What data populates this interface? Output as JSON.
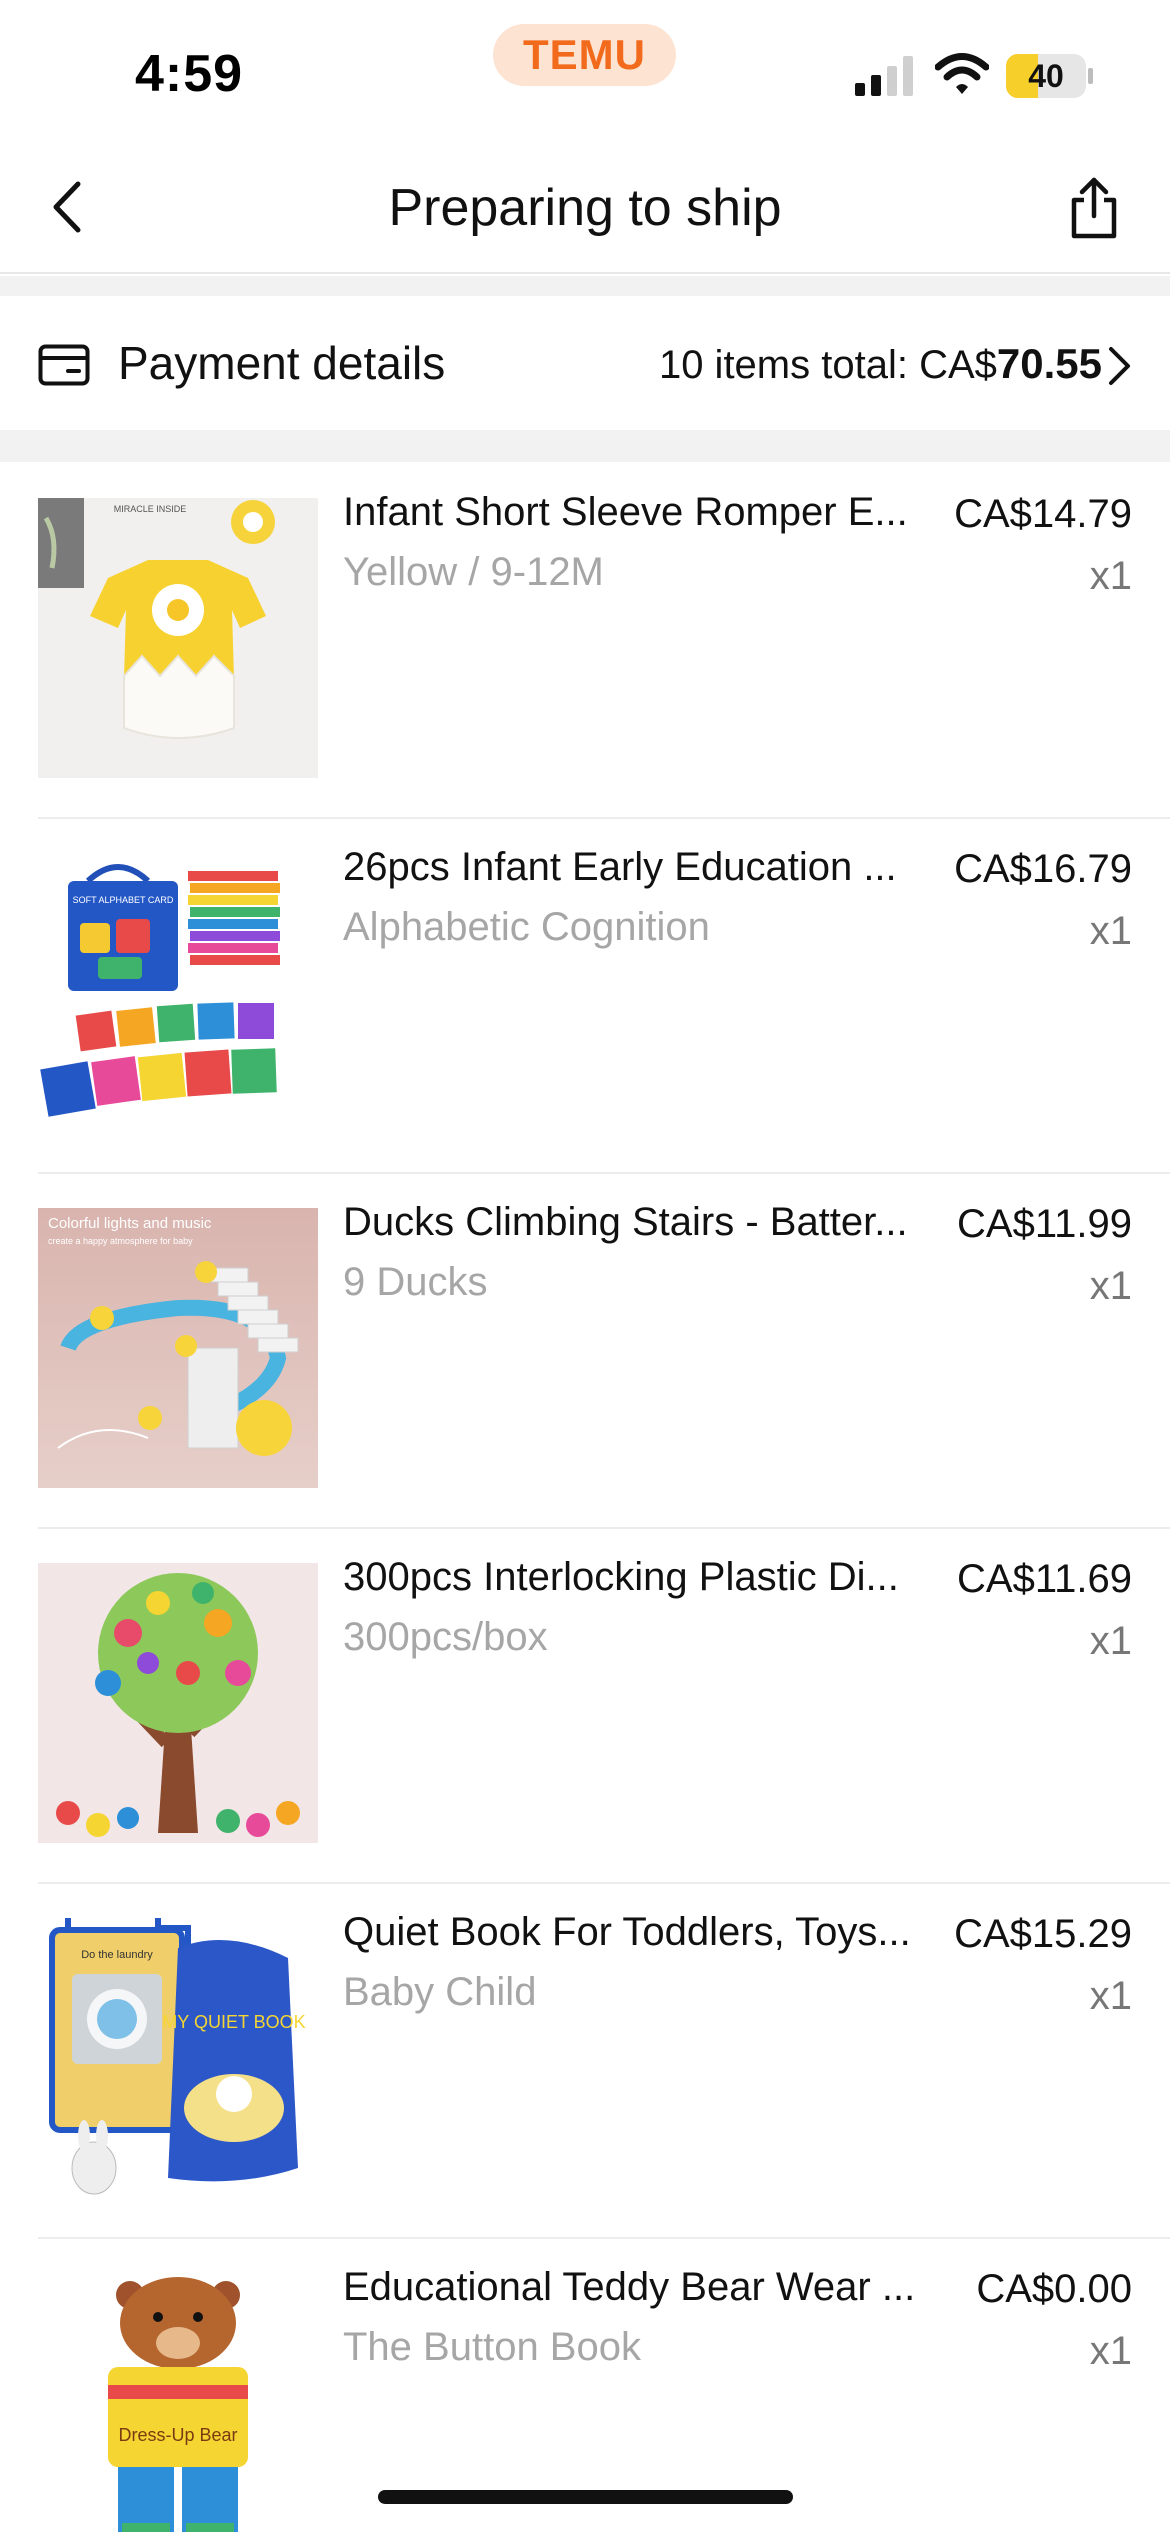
{
  "status_bar": {
    "time": "4:59",
    "brand_badge": "TEMU",
    "battery_level": 40,
    "battery_label": "40"
  },
  "nav": {
    "title": "Preparing to ship",
    "back_icon": "chevron-left-icon",
    "share_icon": "share-icon"
  },
  "payment": {
    "label": "Payment details",
    "total_prefix": "10 items total: ",
    "currency": "CA$",
    "amount": "70.55",
    "icon": "card-icon"
  },
  "items": [
    {
      "title": "Infant Short Sleeve Romper E...",
      "variant": "Yellow / 9-12M",
      "price": "CA$14.79",
      "qty": "x1"
    },
    {
      "title": "26pcs Infant Early Education ...",
      "variant": "Alphabetic Cognition",
      "price": "CA$16.79",
      "qty": "x1"
    },
    {
      "title": "Ducks Climbing Stairs - Batter...",
      "variant": "9 Ducks",
      "price": "CA$11.99",
      "qty": "x1"
    },
    {
      "title": "300pcs Interlocking Plastic Di...",
      "variant": "300pcs/box",
      "price": "CA$11.69",
      "qty": "x1"
    },
    {
      "title": "Quiet Book For Toddlers, Toys...",
      "variant": "Baby Child",
      "price": "CA$15.29",
      "qty": "x1"
    },
    {
      "title": "Educational Teddy Bear Wear ...",
      "variant": "The Button Book",
      "price": "CA$0.00",
      "qty": "x1"
    }
  ],
  "image_text": {
    "romper_tag": "MIRACLE INSIDE",
    "cards_bag": "SOFT ALPHABET CARD",
    "duck_banner": "Colorful lights and music",
    "duck_sub": "create a happy atmosphere for baby",
    "quiet_book_page": "Do the laundry",
    "quiet_book_cover": "MY QUIET BOOK",
    "bear_label": "Dress-Up Bear"
  },
  "colors": {
    "brand_orange": "#f26b1d",
    "brand_pill": "#fde3d2",
    "battery_yellow": "#f6cf2a",
    "muted_text": "#a6a6a6",
    "divider": "#ececec",
    "section_gap": "#f2f2f2"
  }
}
